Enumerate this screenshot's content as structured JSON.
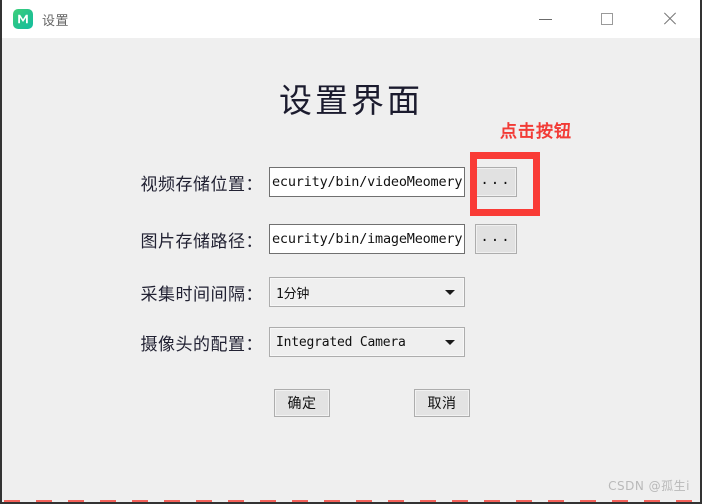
{
  "window": {
    "titlebar": {
      "app_icon": "app-logo-icon",
      "title": "设置",
      "minimize_label": "minimize",
      "maximize_label": "maximize",
      "close_label": "close"
    }
  },
  "main": {
    "page_title": "设置界面",
    "annotation": {
      "text": "点击按钮",
      "color": "#f93b36"
    },
    "fields": [
      {
        "name": "video-storage-path",
        "label": "视频存储位置：",
        "value": "ecurity/bin/videoMeomery",
        "browse_label": "..."
      },
      {
        "name": "image-storage-path",
        "label": "图片存储路径：",
        "value": "ecurity/bin/imageMeomery",
        "browse_label": "..."
      },
      {
        "name": "capture-interval",
        "label": "采集时间间隔：",
        "value": "1分钟"
      },
      {
        "name": "camera-config",
        "label": "摄像头的配置：",
        "value": "Integrated Camera"
      }
    ],
    "buttons": {
      "ok": "确定",
      "cancel": "取消"
    }
  },
  "watermark": "CSDN @孤生i"
}
